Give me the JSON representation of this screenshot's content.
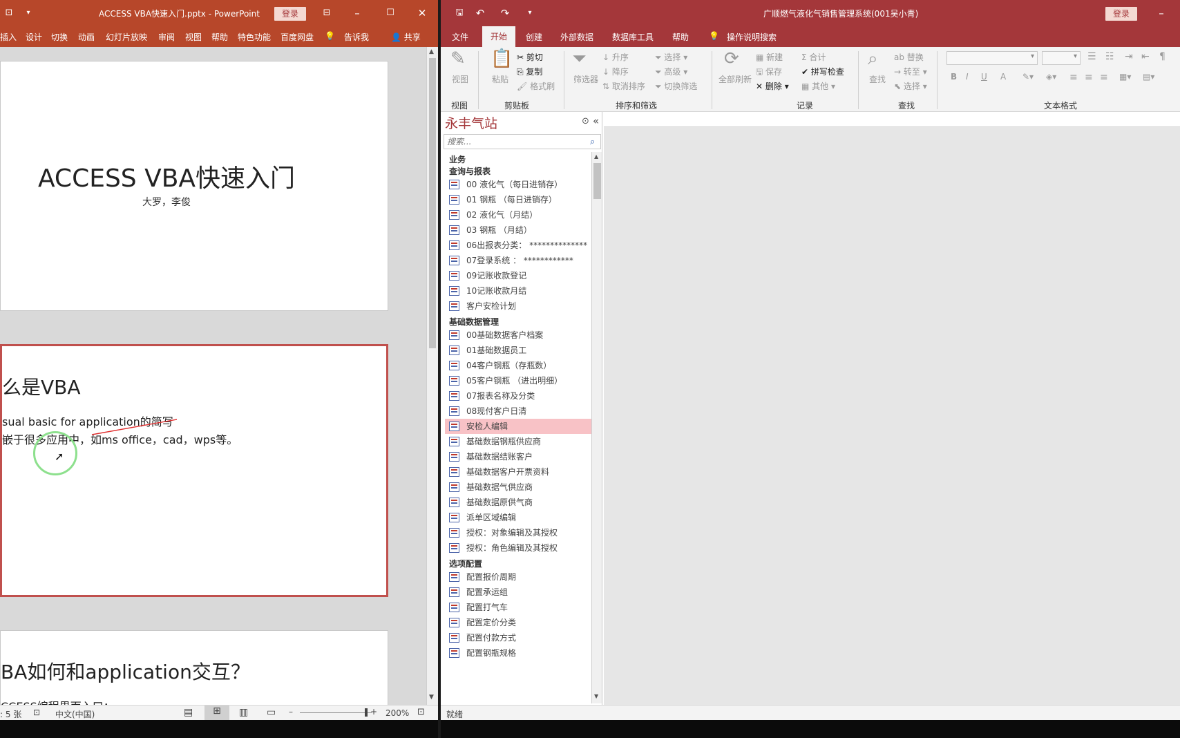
{
  "ppt": {
    "title": "ACCESS VBA快速入门.pptx  -  PowerPoint",
    "login": "登录",
    "menu": [
      "插入",
      "设计",
      "切换",
      "动画",
      "幻灯片放映",
      "审阅",
      "视图",
      "帮助",
      "特色功能",
      "百度网盘",
      "告诉我",
      "共享"
    ],
    "slide1": {
      "title": "ACCESS VBA快速入门",
      "subtitle": "大罗，李俊"
    },
    "slide2": {
      "heading": "么是VBA",
      "line1": "sual basic for application的简写",
      "line2": "嵌于很多应用中，如ms office，cad，wps等。"
    },
    "slide3": {
      "heading": "BA如何和application交互？",
      "line1": "CCESS编程界面入口："
    },
    "status": {
      "slide_count": ": 5 张",
      "language": "中文(中国)",
      "zoom": "200%"
    }
  },
  "access": {
    "title": "广顺燃气液化气销售管理系统(001吴小青)",
    "login": "登录",
    "tabs": [
      "文件",
      "开始",
      "创建",
      "外部数据",
      "数据库工具",
      "帮助",
      "操作说明搜索"
    ],
    "active_tab": "开始",
    "ribbon": {
      "view": {
        "btn": "视图",
        "label": "视图"
      },
      "clipboard": {
        "paste": "粘贴",
        "cut": "剪切",
        "copy": "复制",
        "format_painter": "格式刷",
        "label": "剪贴板"
      },
      "sort": {
        "filter": "筛选器",
        "asc": "升序",
        "desc": "降序",
        "remove_sort": "取消排序",
        "select": "选择",
        "advanced": "高级",
        "toggle": "切换筛选",
        "label": "排序和筛选"
      },
      "records": {
        "refresh": "全部刷新",
        "new": "新建",
        "save": "保存",
        "delete": "删除",
        "total": "合计",
        "spell": "拼写检查",
        "more": "其他",
        "label": "记录"
      },
      "find": {
        "find": "查找",
        "replace": "替换",
        "goto": "转至",
        "select": "选择",
        "label": "查找"
      },
      "textformat": {
        "label": "文本格式",
        "bold": "B",
        "italic": "I",
        "underline": "U",
        "fontcolor": "A"
      }
    },
    "nav": {
      "title": "永丰气站",
      "search_placeholder": "搜索...",
      "business": "业务",
      "groups": [
        {
          "name": "查询与报表",
          "items": [
            "00 液化气（每日进销存）",
            "01 钢瓶 （每日进销存）",
            "02 液化气（月结）",
            "03 钢瓶 （月结）",
            "06出报表分类： **************",
            "07登录系统 ： ************",
            "09记账收款登记",
            "10记账收款月结",
            "客户安检计划"
          ]
        },
        {
          "name": "基础数据管理",
          "items": [
            "00基础数据客户档案",
            "01基础数据员工",
            "04客户钢瓶（存瓶数）",
            "05客户钢瓶 （进出明细）",
            "07报表名称及分类",
            "08现付客户日清",
            "安检人编辑",
            "基础数据钢瓶供应商",
            "基础数据结账客户",
            "基础数据客户开票资料",
            "基础数据气供应商",
            "基础数据原供气商",
            "派单区域编辑",
            "授权：对象编辑及其授权",
            "授权：角色编辑及其授权"
          ]
        },
        {
          "name": "选项配置",
          "items": [
            "配置报价周期",
            "配置承运组",
            "配置打气车",
            "配置定价分类",
            "配置付款方式",
            "配置钢瓶规格"
          ]
        }
      ],
      "selected": "安检人编辑"
    },
    "status": "就绪"
  }
}
